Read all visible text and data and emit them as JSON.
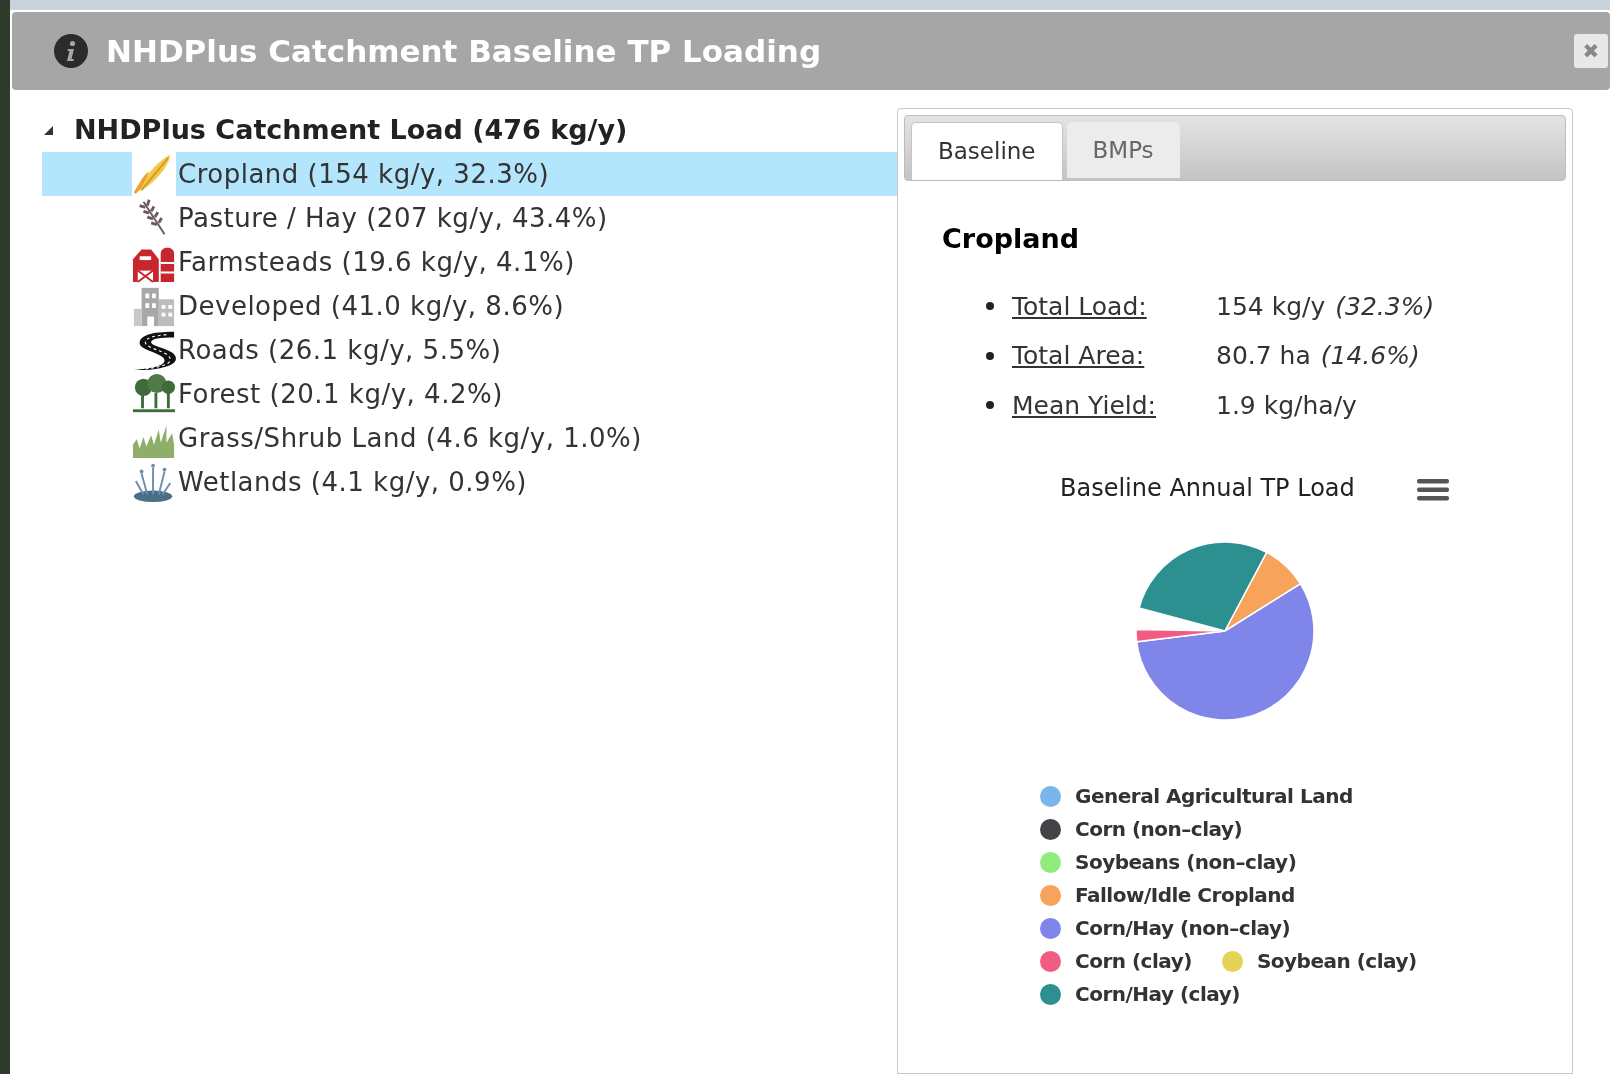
{
  "window": {
    "title": "NHDPlus Catchment Baseline TP Loading",
    "close": "✖"
  },
  "tree": {
    "label": "NHDPlus Catchment Load (476 kg/y)",
    "expanded": true,
    "children": [
      {
        "label": "Cropland (154 kg/y, 32.3%)",
        "selected": true
      },
      {
        "label": "Pasture / Hay (207 kg/y, 43.4%)",
        "selected": false
      },
      {
        "label": "Farmsteads (19.6 kg/y, 4.1%)",
        "selected": false
      },
      {
        "label": "Developed (41.0 kg/y, 8.6%)",
        "selected": false
      },
      {
        "label": "Roads (26.1 kg/y, 5.5%)",
        "selected": false
      },
      {
        "label": "Forest (20.1 kg/y, 4.2%)",
        "selected": false
      },
      {
        "label": "Grass/Shrub Land (4.6 kg/y, 1.0%)",
        "selected": false
      },
      {
        "label": "Wetlands (4.1 kg/y, 0.9%)",
        "selected": false
      }
    ]
  },
  "tabs": [
    {
      "label": "Baseline",
      "selected": true
    },
    {
      "label": "BMPs",
      "selected": false
    }
  ],
  "detail": {
    "title": "Cropland",
    "stats": [
      {
        "label": "Total Load:",
        "value": "154 kg/y",
        "note": "(32.3%)"
      },
      {
        "label": "Total Area:",
        "value": "80.7 ha",
        "note": "(14.6%)"
      },
      {
        "label": "Mean Yield:",
        "value": "1.9 kg/ha/y"
      }
    ]
  },
  "chart": {
    "title": "Baseline Annual TP Load",
    "legend": [
      {
        "label": "General Agricultural Land",
        "color": "#7cb5ec"
      },
      {
        "label": "Corn (non–clay)",
        "color": "#434348"
      },
      {
        "label": "Soybeans (non–clay)",
        "color": "#90ed7d"
      },
      {
        "label": "Fallow/Idle Cropland",
        "color": "#f7a35c"
      },
      {
        "label": "Corn/Hay (non–clay)",
        "color": "#8085e9"
      },
      {
        "label": "Corn (clay)",
        "color": "#f15c80"
      },
      {
        "label": "Soybean (clay)",
        "color": "#e4d354"
      },
      {
        "label": "Corn/Hay (clay)",
        "color": "#2b908f"
      }
    ]
  }
}
